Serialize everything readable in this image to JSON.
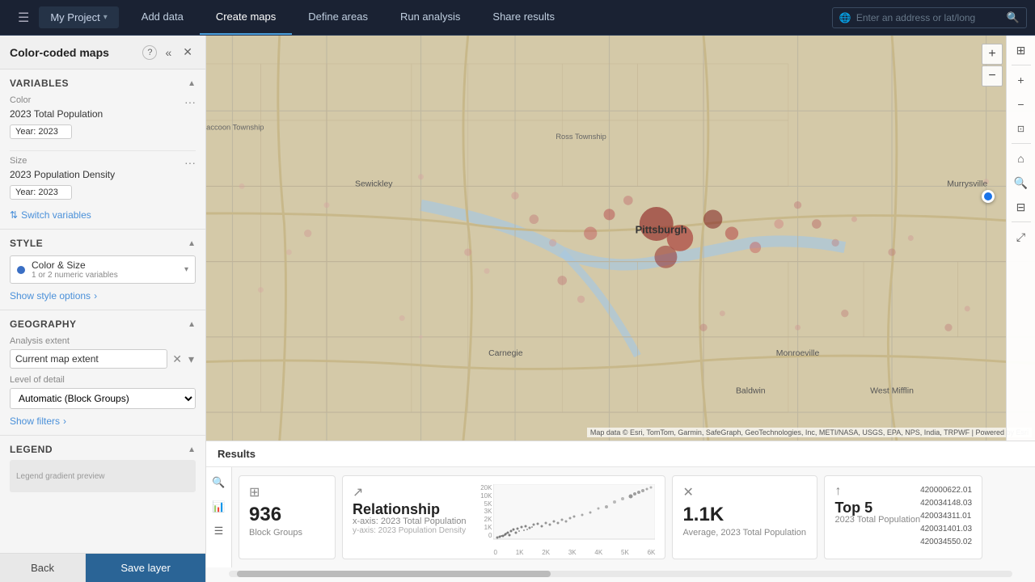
{
  "topbar": {
    "menu_icon": "☰",
    "project_name": "My Project",
    "chevron": "▾",
    "nav_items": [
      {
        "label": "Add data",
        "active": false
      },
      {
        "label": "Create maps",
        "active": true
      },
      {
        "label": "Define areas",
        "active": false
      },
      {
        "label": "Run analysis",
        "active": false
      },
      {
        "label": "Share results",
        "active": false
      }
    ],
    "search_placeholder": "Enter an address or lat/long",
    "search_icon": "🔍"
  },
  "panel": {
    "title": "Color-coded maps",
    "help_icon": "?",
    "collapse_icon": "«",
    "close_icon": "✕",
    "variables_section": {
      "label": "Variables",
      "color_label": "Color",
      "color_var": "2023 Total Population",
      "color_year": "Year: 2023",
      "size_label": "Size",
      "size_var": "2023 Population Density",
      "size_year": "Year: 2023",
      "switch_label": "Switch variables"
    },
    "style_section": {
      "label": "Style",
      "option_label": "Color & Size",
      "option_sub": "1 or 2 numeric variables",
      "show_options": "Show style options"
    },
    "geography_section": {
      "label": "Geography",
      "analysis_label": "Analysis extent",
      "analysis_value": "Current map extent",
      "detail_label": "Level of detail",
      "detail_value": "Automatic (Block Groups)",
      "show_filters": "Show filters"
    },
    "legend_section": {
      "label": "Legend"
    },
    "footer": {
      "back_label": "Back",
      "save_label": "Save layer"
    }
  },
  "results": {
    "title": "Results",
    "cards": [
      {
        "icon": "⊞",
        "value": "936",
        "label": "Block Groups",
        "sublabel": ""
      },
      {
        "icon": "↗",
        "value": "Relationship",
        "label": "x-axis: 2023 Total Population",
        "sublabel": "y-axis: 2023 Population Density"
      },
      {
        "icon": "✕",
        "value": "1.1K",
        "label": "Average, 2023 Total Population",
        "sublabel": ""
      },
      {
        "icon": "↑",
        "value": "Top 5",
        "label": "2023 Total Population",
        "sublabel": ""
      }
    ],
    "scatter": {
      "y_labels": [
        "20K",
        "10K",
        "5K",
        "3K",
        "2K",
        "1K",
        "0"
      ],
      "x_labels": [
        "0",
        "1K",
        "2K",
        "3K",
        "4K",
        "5K",
        "6K"
      ]
    },
    "top5": [
      "420000622.01",
      "420034148.03",
      "420034311.01",
      "420031401.03",
      "420034550.02"
    ]
  },
  "map": {
    "attribution": "Map data © Esri, TomTom, Garmin, SafeGraph, GeoTechnologies, Inc, METI/NASA, USGS, EPA, NPS, India, TRPWF | Powered by Esri"
  }
}
